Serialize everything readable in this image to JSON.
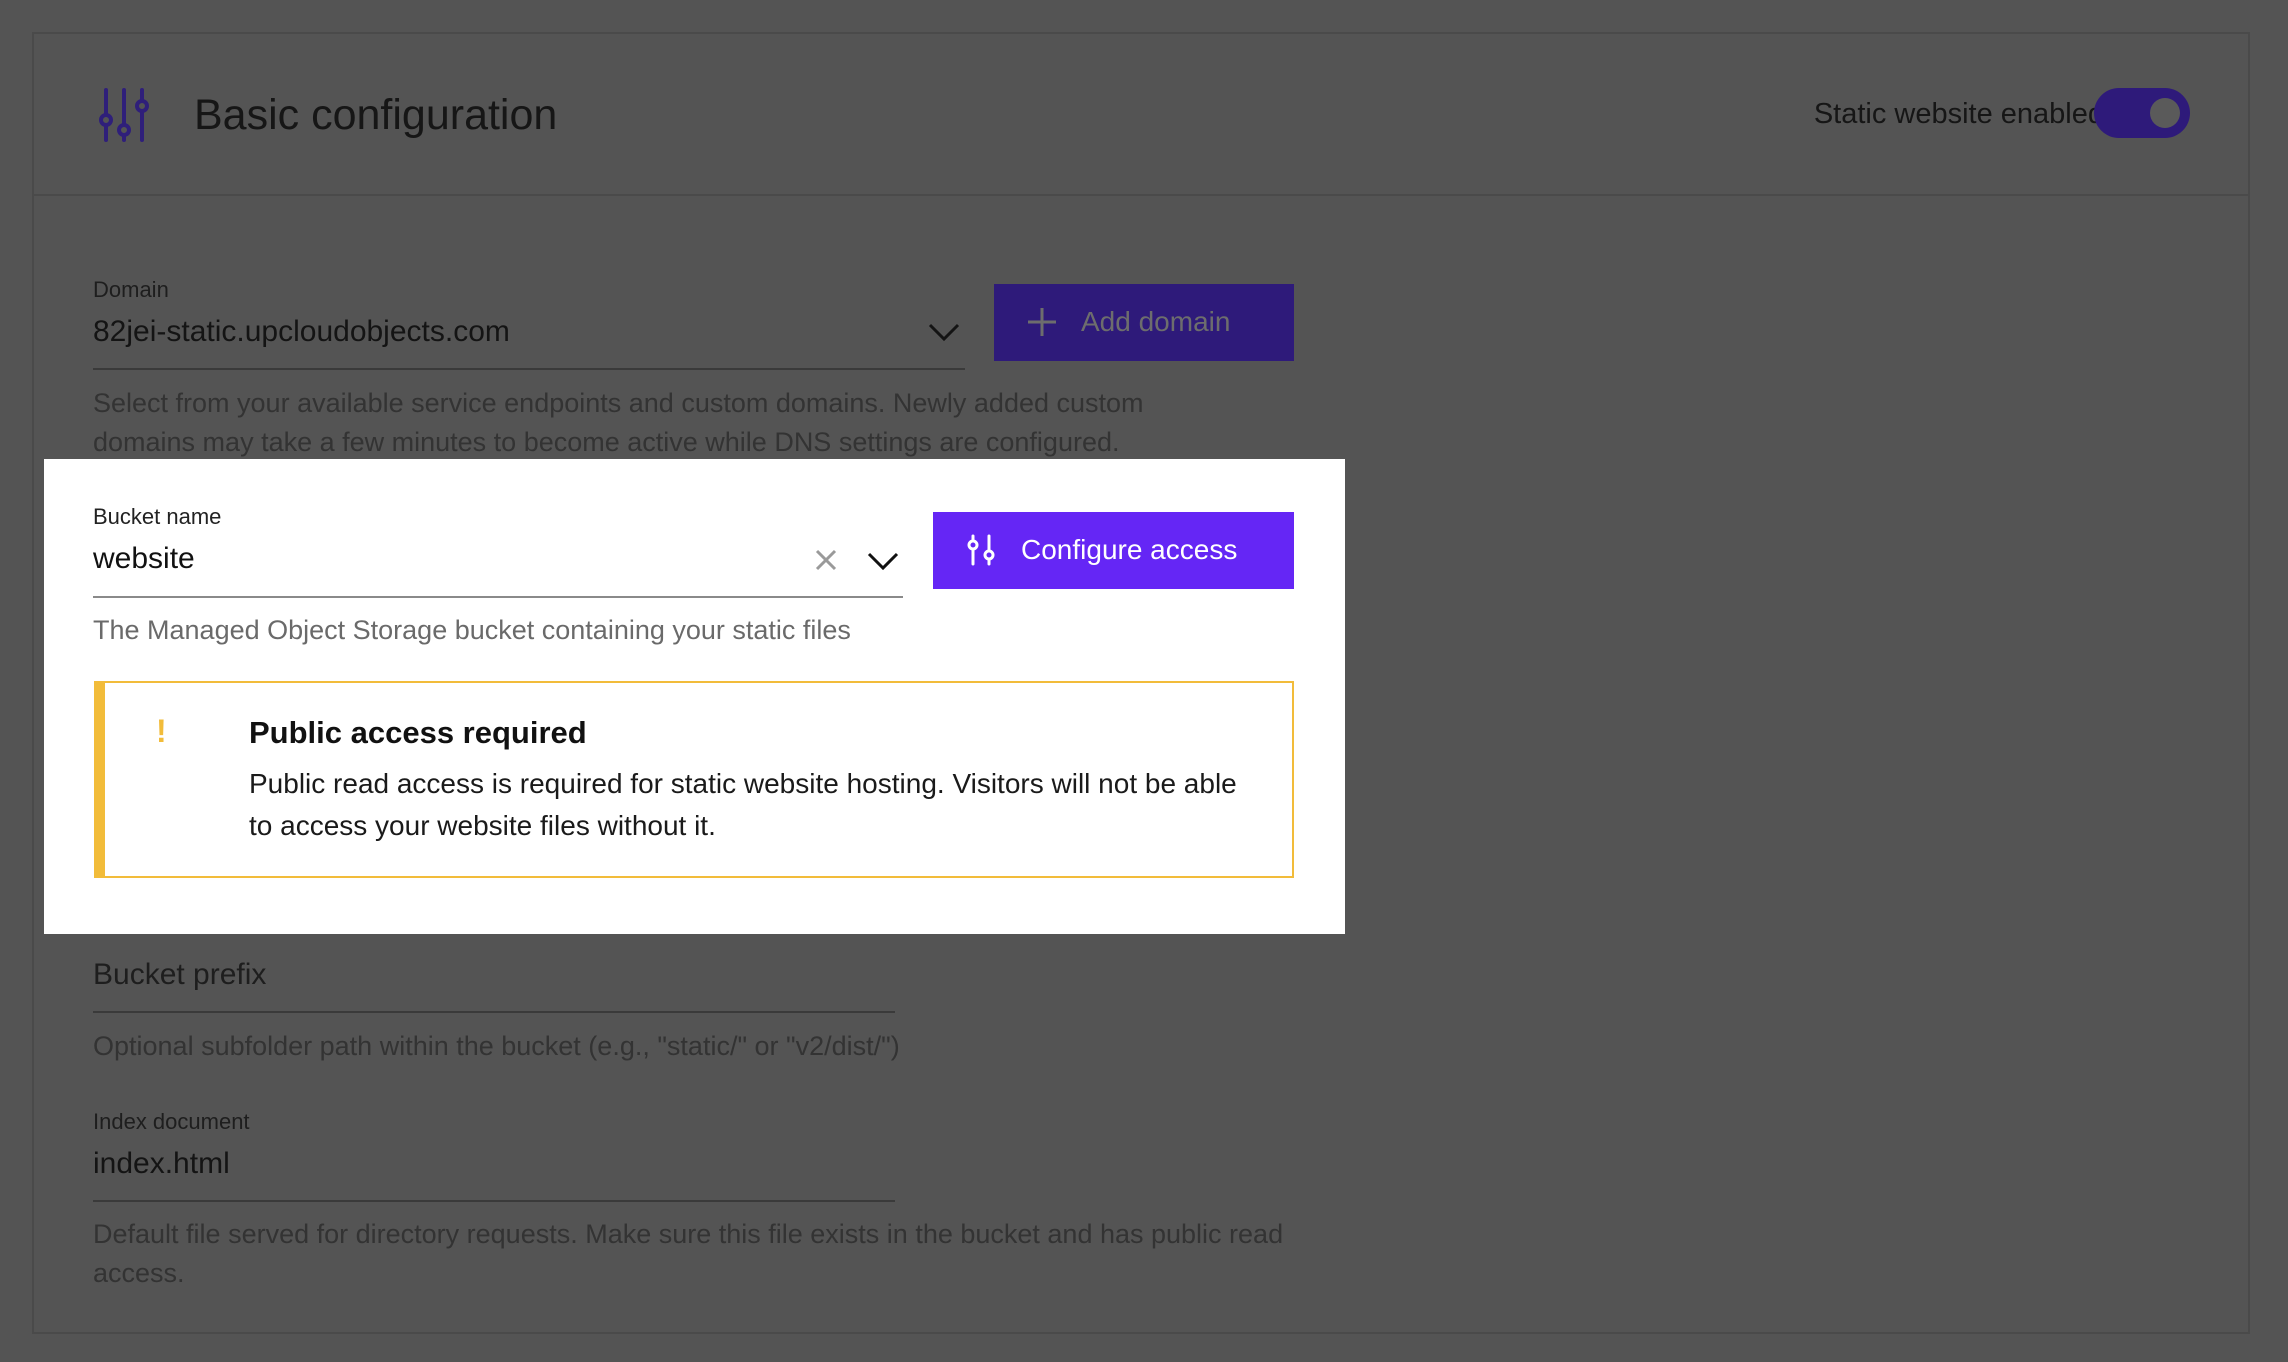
{
  "header": {
    "title": "Basic configuration",
    "icon": "sliders-icon",
    "toggle_label": "Static website enabled",
    "toggle_state": "on"
  },
  "domain": {
    "label": "Domain",
    "value": "82jei-static.upcloudobjects.com",
    "helper": "Select from your available service endpoints and custom domains. Newly added custom domains may take a few minutes to become active while DNS settings are configured.",
    "add_button": "Add domain"
  },
  "bucket": {
    "label": "Bucket name",
    "value": "website",
    "helper": "The Managed Object Storage bucket containing your static files",
    "configure_button": "Configure access"
  },
  "alert": {
    "mark": "!",
    "title": "Public access required",
    "body": "Public read access is required for static website hosting. Visitors will not be able to access your website files without it."
  },
  "prefix": {
    "placeholder": "Bucket prefix",
    "helper": "Optional subfolder path within the bucket (e.g., \"static/\" or \"v2/dist/\")"
  },
  "index_document": {
    "label": "Index document",
    "value": "index.html",
    "helper": "Default file served for directory requests. Make sure this file exists in the bucket and has public read access."
  },
  "colors": {
    "overlay": "#545454",
    "primary": "#6526f5",
    "primary_dimmed": "#2e1a7a",
    "warning": "#f2bc3a"
  }
}
